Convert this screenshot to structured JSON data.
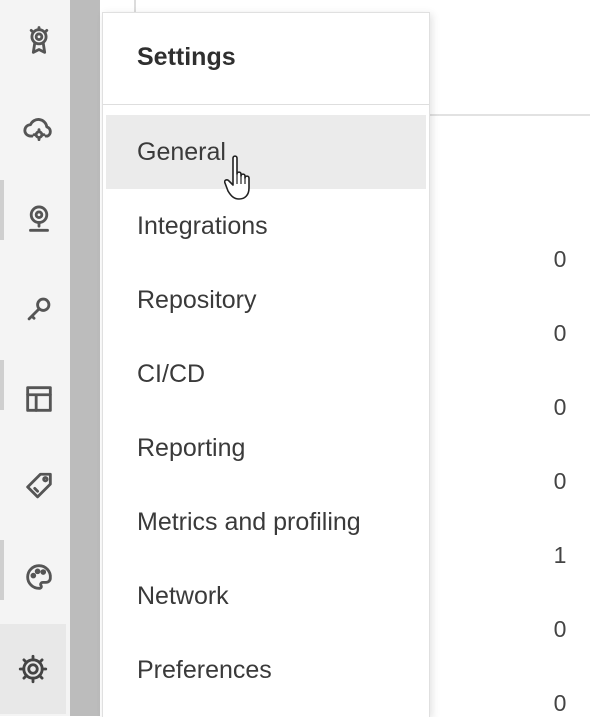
{
  "sidebar": {
    "icons": [
      {
        "name": "award-icon"
      },
      {
        "name": "cloud-gear-icon"
      },
      {
        "name": "location-pin-icon"
      },
      {
        "name": "key-icon"
      },
      {
        "name": "layout-icon"
      },
      {
        "name": "tag-icon"
      },
      {
        "name": "palette-icon"
      },
      {
        "name": "gear-icon",
        "active": true
      }
    ]
  },
  "settings_menu": {
    "title": "Settings",
    "items": [
      {
        "label": "General",
        "hovered": true
      },
      {
        "label": "Integrations"
      },
      {
        "label": "Repository"
      },
      {
        "label": "CI/CD"
      },
      {
        "label": "Reporting"
      },
      {
        "label": "Metrics and profiling"
      },
      {
        "label": "Network"
      },
      {
        "label": "Preferences"
      }
    ]
  },
  "background": {
    "counts": [
      "0",
      "0",
      "0",
      "0",
      "1",
      "0",
      "0"
    ]
  },
  "colors": {
    "hover_bg": "#ebebeb",
    "rail_bg": "#f4f4f4",
    "strip": "#bcbcbc"
  }
}
